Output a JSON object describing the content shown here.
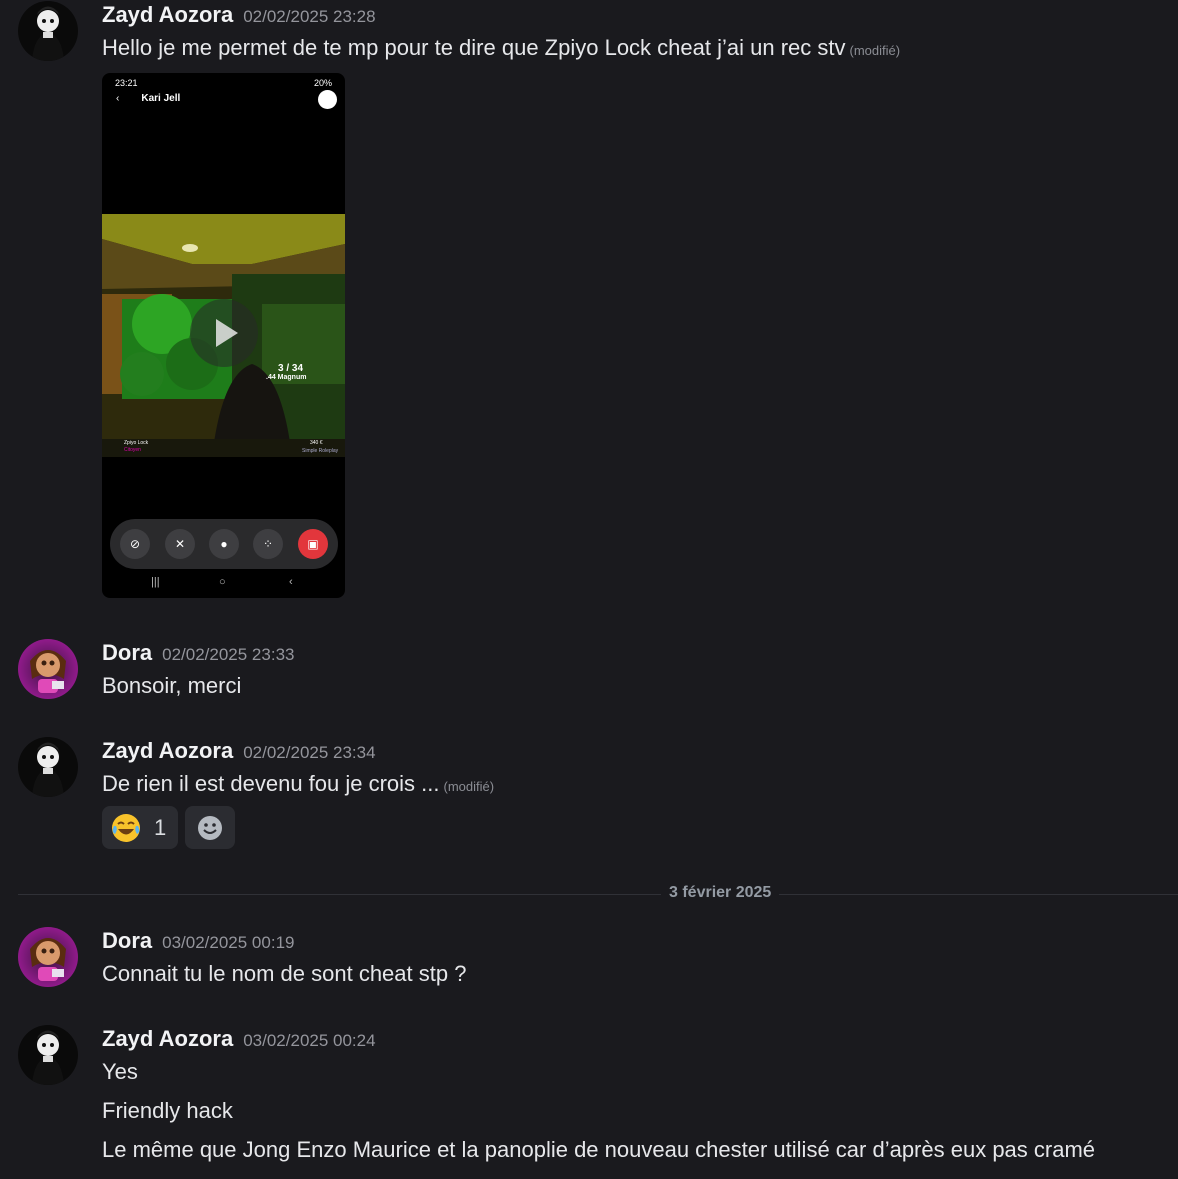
{
  "messages": [
    {
      "author": "Zayd Aozora",
      "timestamp": "02/02/2025 23:28",
      "avatar": "zayd-avatar",
      "lines": [
        {
          "text": "Hello je me permet de te mp pour te dire que Zpiyo Lock cheat j’ai un rec stv",
          "edited": "(modifié)"
        }
      ],
      "attachment": {
        "type": "video",
        "status_time": "23:21",
        "status_battery": "20%",
        "caller_name": "Kari Jell",
        "ammo": "3 / 34",
        "weapon": ".44 Magnum",
        "hud_name": "Zpiyo Lock",
        "hud_job": "Citoyen",
        "hud_money": "340 €",
        "hud_server": "Simple Roleplay"
      }
    },
    {
      "author": "Dora",
      "timestamp": "02/02/2025 23:33",
      "avatar": "dora-avatar",
      "lines": [
        {
          "text": "Bonsoir, merci"
        }
      ]
    },
    {
      "author": "Zayd Aozora",
      "timestamp": "02/02/2025 23:34",
      "avatar": "zayd-avatar",
      "lines": [
        {
          "text": "De rien il est devenu fou je crois ...",
          "edited": "(modifié)"
        }
      ],
      "reactions": [
        {
          "emoji": "joy-emoji",
          "count": "1"
        },
        {
          "emoji": "add-reaction-icon"
        }
      ]
    },
    {
      "author": "Dora",
      "timestamp": "03/02/2025 00:19",
      "avatar": "dora-avatar",
      "lines": [
        {
          "text": "Connait tu le nom de sont cheat stp ?"
        }
      ]
    },
    {
      "author": "Zayd Aozora",
      "timestamp": "03/02/2025 00:24",
      "avatar": "zayd-avatar",
      "lines": [
        {
          "text": "Yes"
        },
        {
          "text": "Friendly hack"
        },
        {
          "text": "Le même que Jong Enzo Maurice et la panoplie de nouveau chester utilisé car d’après eux pas cramé"
        }
      ]
    }
  ],
  "date_divider": "3 février 2025",
  "colors": {
    "background": "#1a1a1e",
    "author": "#f2f3f5",
    "timestamp": "#94959c",
    "reaction_bg": "#2b2c31",
    "end_call": "#e2363c"
  }
}
